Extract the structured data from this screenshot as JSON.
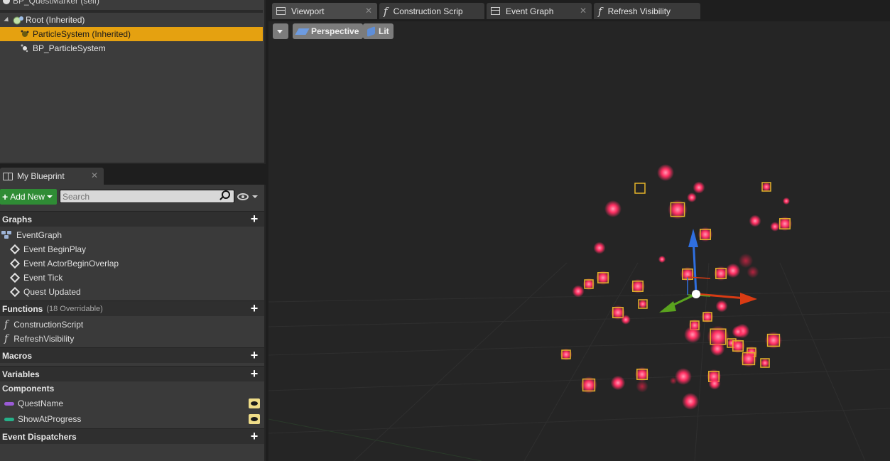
{
  "components": {
    "self_label": "BP_QuestMarker (self)",
    "items": [
      {
        "label": "Root (Inherited)"
      },
      {
        "label": "ParticleSystem (Inherited)"
      },
      {
        "label": "BP_ParticleSystem"
      }
    ]
  },
  "my_blueprint": {
    "tab_label": "My Blueprint",
    "add_new_label": "Add New",
    "search_placeholder": "Search",
    "categories": {
      "graphs": "Graphs",
      "functions": "Functions",
      "functions_sub": "(18 Overridable)",
      "macros": "Macros",
      "variables": "Variables",
      "event_dispatchers": "Event Dispatchers"
    },
    "event_graph": "EventGraph",
    "events": [
      "Event BeginPlay",
      "Event ActorBeginOverlap",
      "Event Tick",
      "Quest Updated"
    ],
    "functions": [
      "ConstructionScript",
      "RefreshVisibility"
    ],
    "components_header": "Components",
    "variables": [
      {
        "label": "QuestName",
        "color": "#9a5bd6"
      },
      {
        "label": "ShowAtProgress",
        "color": "#26b089"
      }
    ]
  },
  "tabs": [
    "Viewport",
    "Construction Scrip",
    "Event Graph",
    "Refresh Visibility"
  ],
  "viewport_toolbar": {
    "perspective": "Perspective",
    "lit": "Lit"
  },
  "colors": {
    "selection": "#e5a110",
    "add_new": "#2f8c35",
    "particle": "#ff3b6b",
    "gizmo_x": "#d93b13",
    "gizmo_y": "#5aa31e",
    "gizmo_z": "#2f6fe0"
  }
}
